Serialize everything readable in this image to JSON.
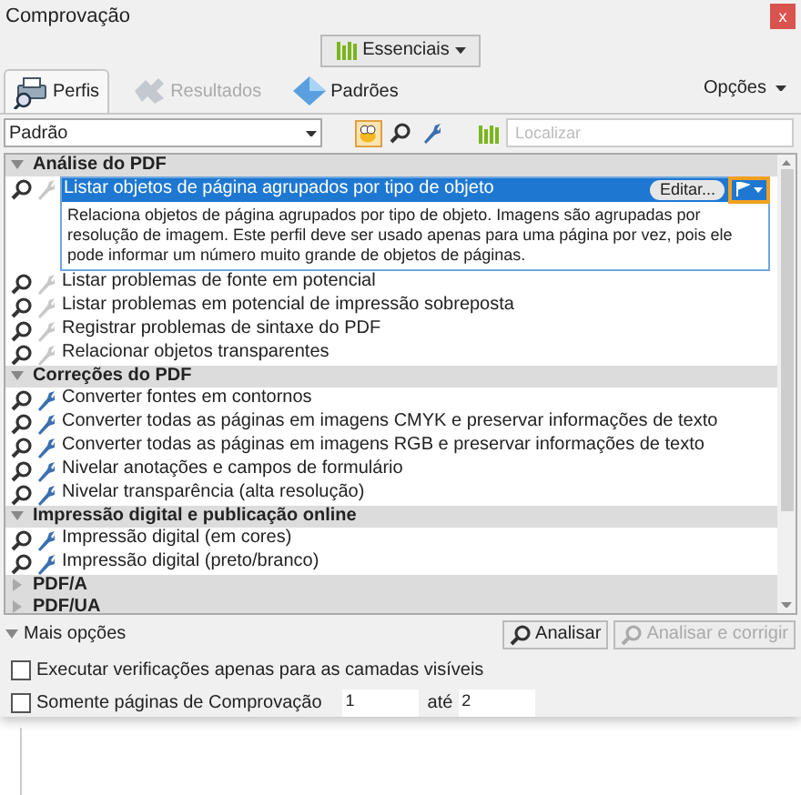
{
  "window": {
    "title": "Comprovação",
    "close": "x"
  },
  "workspace_button": {
    "label": "Essenciais"
  },
  "tabs": [
    {
      "label": "Perfis",
      "selected": true,
      "disabled": false
    },
    {
      "label": "Resultados",
      "selected": false,
      "disabled": true
    },
    {
      "label": "Padrões",
      "selected": false,
      "disabled": false
    }
  ],
  "options_menu": {
    "label": "Opções"
  },
  "profile_select": {
    "value": "Padrão"
  },
  "search": {
    "placeholder": "Localizar"
  },
  "groups": [
    {
      "title": "Análise do PDF",
      "expanded": true,
      "items": [
        {
          "label": "Listar objetos de página agrupados por tipo de objeto",
          "fixable": false,
          "selected": true,
          "description": "Relaciona objetos de página agrupados por tipo de objeto. Imagens são agrupadas por resolução de imagem. Este perfil deve ser usado apenas para uma página por vez, pois ele pode informar um número muito grande de objetos de páginas.",
          "edit_button": "Editar..."
        },
        {
          "label": "Listar problemas de fonte em potencial",
          "fixable": false,
          "selected": false
        },
        {
          "label": "Listar problemas em potencial de impressão sobreposta",
          "fixable": false,
          "selected": false
        },
        {
          "label": "Registrar problemas de sintaxe do PDF",
          "fixable": false,
          "selected": false
        },
        {
          "label": "Relacionar objetos transparentes",
          "fixable": false,
          "selected": false
        }
      ]
    },
    {
      "title": "Correções do PDF",
      "expanded": true,
      "items": [
        {
          "label": "Converter fontes em contornos",
          "fixable": true,
          "selected": false
        },
        {
          "label": "Converter todas as páginas em imagens CMYK e preservar informações de texto",
          "fixable": true,
          "selected": false
        },
        {
          "label": "Converter todas as páginas em imagens RGB e preservar informações de texto",
          "fixable": true,
          "selected": false
        },
        {
          "label": "Nivelar anotações e campos de formulário",
          "fixable": true,
          "selected": false
        },
        {
          "label": "Nivelar transparência (alta resolução)",
          "fixable": true,
          "selected": false
        }
      ]
    },
    {
      "title": "Impressão digital e publicação online",
      "expanded": true,
      "items": [
        {
          "label": "Impressão digital (em cores)",
          "fixable": true,
          "selected": false
        },
        {
          "label": "Impressão digital (preto/branco)",
          "fixable": true,
          "selected": false
        }
      ]
    },
    {
      "title": "PDF/A",
      "expanded": false
    },
    {
      "title": "PDF/UA",
      "expanded": false
    }
  ],
  "more_options": {
    "label": "Mais opções",
    "expanded": true
  },
  "actions": [
    {
      "label": "Analisar",
      "disabled": false
    },
    {
      "label": "Analisar e corrigir",
      "disabled": true
    }
  ],
  "checkboxes": [
    {
      "label": "Executar verificações apenas para as camadas visíveis",
      "checked": false
    },
    {
      "label": "Somente páginas de Comprovação",
      "checked": false
    }
  ],
  "page_range": {
    "from": "1",
    "separator": "até",
    "to": "2"
  }
}
